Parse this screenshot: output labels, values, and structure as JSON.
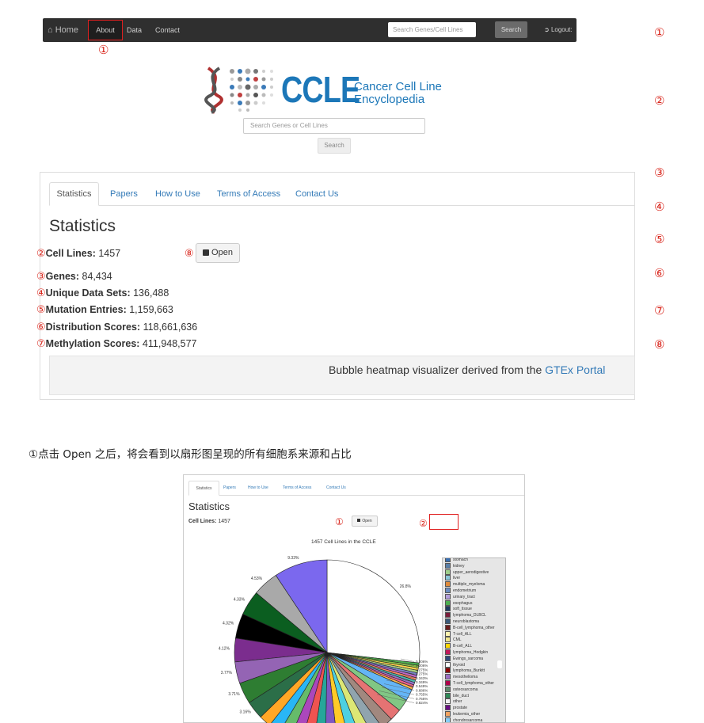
{
  "navbar": {
    "home_label": "Home",
    "about_label": "About",
    "data_label": "Data",
    "contact_label": "Contact",
    "search_placeholder": "Search Genes/Cell Lines",
    "search_button": "Search",
    "logout_label": "Logout:"
  },
  "logo": {
    "name": "CCLE",
    "subtitle_line1": "Cancer Cell Line",
    "subtitle_line2": "Encyclopedia"
  },
  "hero_search": {
    "placeholder": "Search Genes or Cell Lines",
    "button": "Search"
  },
  "right_markers": [
    "①",
    "②",
    "③",
    "④",
    "⑤",
    "⑥",
    "⑦",
    "⑧"
  ],
  "panel1": {
    "tabs": [
      "Statistics",
      "Papers",
      "How to Use",
      "Terms of Access",
      "Contact Us"
    ],
    "heading": "Statistics",
    "stats": [
      {
        "marker": "②",
        "label": "Cell Lines:",
        "value": "1457"
      },
      {
        "marker": "③",
        "label": "Genes:",
        "value": "84,434"
      },
      {
        "marker": "④",
        "label": "Unique Data Sets:",
        "value": "136,488"
      },
      {
        "marker": "⑤",
        "label": "Mutation Entries:",
        "value": "1,159,663"
      },
      {
        "marker": "⑥",
        "label": "Distribution Scores:",
        "value": "118,661,636"
      },
      {
        "marker": "⑦",
        "label": "Methylation Scores:",
        "value": "411,948,577"
      }
    ],
    "open_marker": "⑧",
    "open_button": "Open",
    "banner_text": "Bubble heatmap visualizer derived from the",
    "banner_link": "GTEx Portal",
    "about_marker": "①"
  },
  "caption": "①点击 Open 之后，将会看到以扇形图呈现的所有细胞系来源和占比",
  "panel2": {
    "tabs": [
      "Statistics",
      "Papers",
      "How to Use",
      "Terms of Access",
      "Contact Us"
    ],
    "heading": "Statistics",
    "cell_lines_label": "Cell Lines:",
    "cell_lines_value": "1457",
    "open_marker": "①",
    "open_button": "Open",
    "box_marker": "②",
    "chart_title": "1457 Cell Lines in the CCLE"
  },
  "chart_data": {
    "type": "pie",
    "title": "1457 Cell Lines in the CCLE",
    "slice_labels": [
      "26.8%",
      "9.33%",
      "4.53%",
      "4.33%",
      "4.32%",
      "4.12%",
      "3.77%",
      "3.71%",
      "3.16%"
    ],
    "values": [
      26.8,
      9.33,
      4.53,
      4.33,
      4.32,
      4.12,
      3.77,
      3.71,
      3.16
    ],
    "colors": [
      "#ffffff",
      "#7b68ee",
      "#a9a9a9",
      "#0b5e20",
      "#000000",
      "#7b2d8e",
      "#9464b4",
      "#2e7d32",
      "#2b6e48"
    ],
    "small_labels": [
      "0.206%",
      "0.206%",
      "0.275%",
      "0.275%",
      "0.343%",
      "0.349%",
      "0.549%",
      "0.686%",
      "0.755%",
      "0.755%",
      "0.824%"
    ],
    "legend": [
      {
        "name": "stomach",
        "color": "#3a6fb0"
      },
      {
        "name": "kidney",
        "color": "#5a7fa8"
      },
      {
        "name": "upper_aerodigestive",
        "color": "#9ecf8a"
      },
      {
        "name": "liver",
        "color": "#8ac6d8"
      },
      {
        "name": "multiple_myeloma",
        "color": "#e08b3a"
      },
      {
        "name": "endometrium",
        "color": "#6a8cc0"
      },
      {
        "name": "urinary_tract",
        "color": "#b39ddb"
      },
      {
        "name": "esophagus",
        "color": "#4caf50"
      },
      {
        "name": "soft_tissue",
        "color": "#1e3a5f"
      },
      {
        "name": "lymphoma_DLBCL",
        "color": "#7a1c3a"
      },
      {
        "name": "neuroblastoma",
        "color": "#3a5a7a"
      },
      {
        "name": "B-cell_lymphoma_other",
        "color": "#6a1b1b"
      },
      {
        "name": "T-cell_ALL",
        "color": "#fff4b0"
      },
      {
        "name": "CML",
        "color": "#f0e68c"
      },
      {
        "name": "B-cell_ALL",
        "color": "#ffd700"
      },
      {
        "name": "lymphoma_Hodgkin",
        "color": "#c2185b"
      },
      {
        "name": "Ewings_sarcoma",
        "color": "#2e4a7a"
      },
      {
        "name": "thyroid",
        "color": "#ffffff"
      },
      {
        "name": "lymphoma_Burkitt",
        "color": "#8b0000"
      },
      {
        "name": "mesothelioma",
        "color": "#9c6ec4"
      },
      {
        "name": "T-cell_lymphoma_other",
        "color": "#b0004a"
      },
      {
        "name": "osteosarcoma",
        "color": "#5c8a6a"
      },
      {
        "name": "bile_duct",
        "color": "#2e8b57"
      },
      {
        "name": "other",
        "color": "#f5f5f5"
      },
      {
        "name": "prostate",
        "color": "#6a0d83"
      },
      {
        "name": "leukemia_other",
        "color": "#f4a460"
      },
      {
        "name": "chondrosarcoma",
        "color": "#87cefa"
      }
    ]
  }
}
